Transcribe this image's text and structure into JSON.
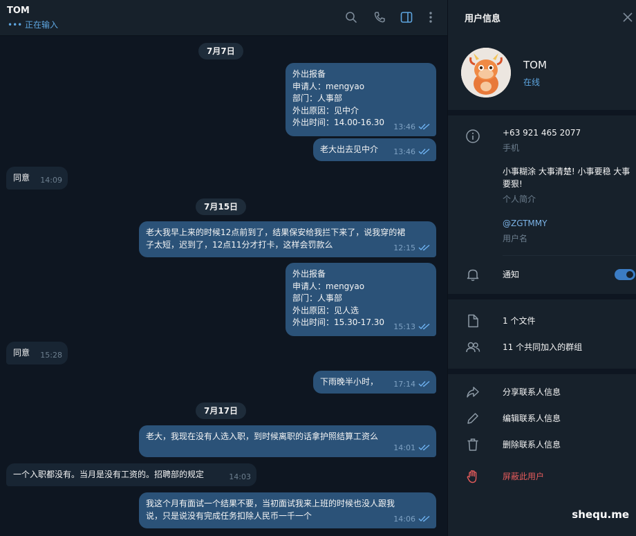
{
  "header": {
    "name": "TOM",
    "status": "••• 正在输入"
  },
  "messages": {
    "dates": [
      "7月7日",
      "7月15日",
      "7月17日"
    ],
    "items": [
      {
        "text": "外出报备\n申请人：mengyao\n部门：人事部\n外出原因：见中介\n外出时间：14.00-16.30",
        "time": "13:46"
      },
      {
        "text": "老大出去见中介",
        "time": "13:46"
      },
      {
        "text": "同意",
        "time": "14:09"
      },
      {
        "text": "老大我早上来的时候12点前到了，结果保安给我拦下来了，说我穿的裙\n子太短，迟到了，12点11分才打卡，这样会罚款么",
        "time": "12:15"
      },
      {
        "text": "外出报备\n申请人：mengyao\n部门：人事部\n外出原因：见人选\n外出时间：15.30-17.30",
        "time": "15:13"
      },
      {
        "text": "同意",
        "time": "15:28"
      },
      {
        "text": "下雨晚半小时，",
        "time": "17:14"
      },
      {
        "text": "老大，我现在没有人选入职，到时候离职的话拿护照结算工资么",
        "time": "14:01"
      },
      {
        "text": "一个入职都没有。当月是没有工资的。招聘部的规定",
        "time": "14:03"
      },
      {
        "text": "我这个月有面试一个结果不要，当初面试我来上班的时候也没人跟我\n说，只是说没有完成任务扣除人民币一千一个",
        "time": "14:06"
      }
    ]
  },
  "info": {
    "title": "用户信息",
    "name": "TOM",
    "status": "在线",
    "phone": "+63 921 465 2077",
    "phone_label": "手机",
    "bio": "小事糊涂 大事清楚! 小事要稳 大事要狠!",
    "bio_label": "个人简介",
    "username": "@ZGTMMY",
    "username_label": "用户名",
    "notify_label": "通知",
    "notify_on": true,
    "files": "1 个文件",
    "groups": "11 个共同加入的群组",
    "share": "分享联系人信息",
    "edit": "编辑联系人信息",
    "delete": "删除联系人信息",
    "block": "屏蔽此用户"
  },
  "watermark": "shequ.me",
  "colors": {
    "outgoing_bubble": "#2b5278",
    "incoming_bubble": "#182533",
    "accent": "#5ea6e0",
    "danger": "#e45b5b"
  }
}
